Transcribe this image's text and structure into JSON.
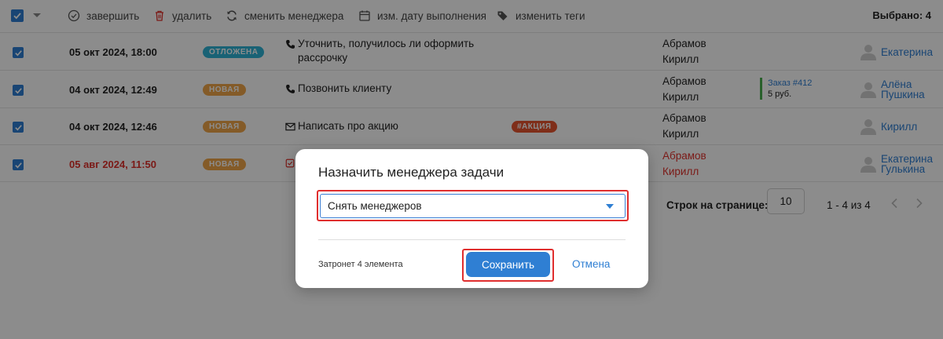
{
  "toolbar": {
    "complete": "завершить",
    "delete": "удалить",
    "change_manager": "сменить менеджера",
    "change_due_date": "изм. дату выполнения",
    "change_tags": "изменить теги",
    "selected": "Выбрано: 4"
  },
  "rows": [
    {
      "date": "05 окт 2024, 18:00",
      "status": "ОТЛОЖЕНА",
      "task_icon": "phone-icon",
      "title": "Уточнить, получилось ли оформить рассрочку",
      "tag": "",
      "owner": "Абрамов Кирилл",
      "order": "",
      "order_sum": "",
      "manager": "Екатерина",
      "overdue": false
    },
    {
      "date": "04 окт 2024, 12:49",
      "status": "НОВАЯ",
      "task_icon": "phone-icon",
      "title": "Позвонить клиенту",
      "tag": "",
      "owner": "Абрамов Кирилл",
      "order": "Заказ #412",
      "order_sum": "5 руб.",
      "manager": "Алёна Пушкина",
      "overdue": false
    },
    {
      "date": "04 окт 2024, 12:46",
      "status": "НОВАЯ",
      "task_icon": "envelope-icon",
      "title": "Написать про акцию",
      "tag": "#АКЦИЯ",
      "owner": "Абрамов Кирилл",
      "order": "",
      "order_sum": "",
      "manager": "Кирилл",
      "overdue": false
    },
    {
      "date": "05 авг 2024, 11:50",
      "status": "НОВАЯ",
      "task_icon": "checkbox-icon",
      "title": "",
      "tag": "",
      "owner": "Абрамов Кирилл",
      "order": "",
      "order_sum": "",
      "manager": "Екатерина Гулькина",
      "overdue": true
    }
  ],
  "pagination": {
    "rows_label": "Строк на странице:",
    "rows_per_page": "10",
    "range": "1 - 4 из 4"
  },
  "modal": {
    "title": "Назначить менеджера задачи",
    "select_value": "Снять менеджеров",
    "affected": "Затронет 4 элемента",
    "save": "Сохранить",
    "cancel": "Отмена"
  },
  "colors": {
    "accent": "#2f7fd3",
    "status_postponed": "#2fb3d6",
    "status_new": "#f0a74a",
    "tag": "#e8542f",
    "overdue": "#e0312b",
    "highlight": "#e02e2e"
  }
}
